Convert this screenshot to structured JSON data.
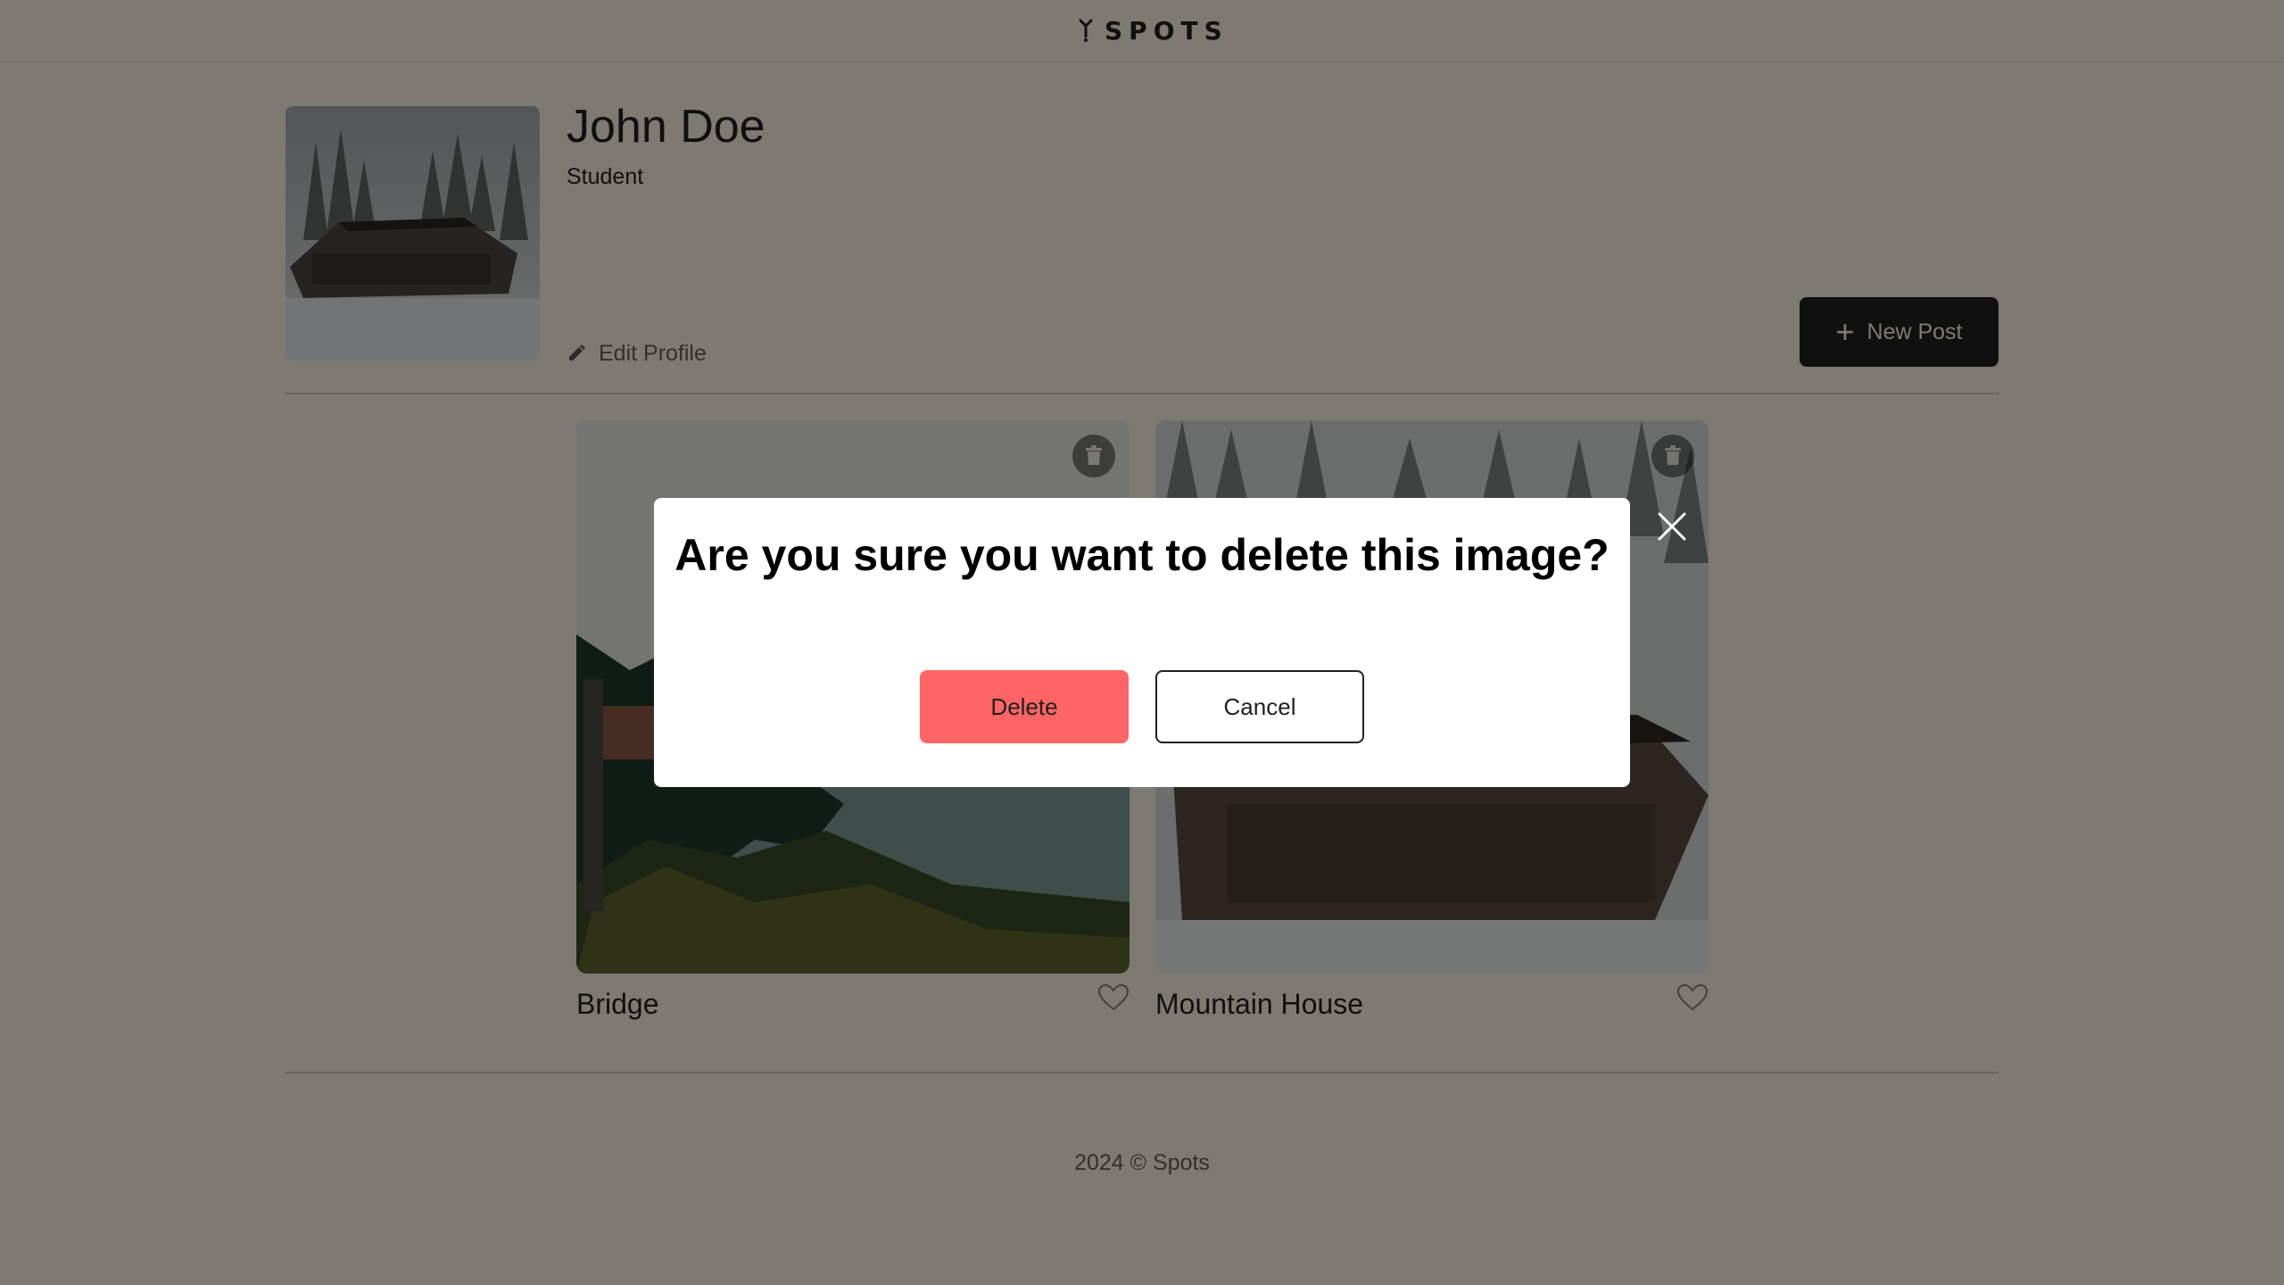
{
  "header": {
    "logo_text": "SPOTS"
  },
  "profile": {
    "name": "John Doe",
    "description": "Student",
    "edit_label": "Edit Profile",
    "new_post_label": "New Post",
    "new_post_icon": "+"
  },
  "cards": [
    {
      "title": "Bridge"
    },
    {
      "title": "Mountain House"
    }
  ],
  "footer": {
    "text": "2024 © Spots"
  },
  "modal": {
    "title": "Are you sure you want to delete this image?",
    "delete_label": "Delete",
    "cancel_label": "Cancel"
  },
  "colors": {
    "background": "#fcf5e5",
    "text": "#212121",
    "danger": "#ff6565",
    "modal_bg": "#ffffff"
  }
}
